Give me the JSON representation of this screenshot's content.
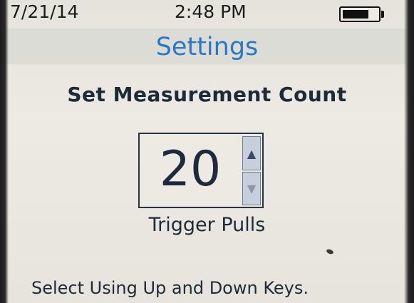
{
  "status_bar": {
    "date": "7/21/14",
    "time": "2:48 PM",
    "battery_level": 0.75
  },
  "header": {
    "title": "Settings"
  },
  "main": {
    "heading": "Set Measurement Count",
    "count_value": "20",
    "up_icon": "triangle-up-icon",
    "down_icon": "triangle-down-icon",
    "unit_label": "Trigger Pulls"
  },
  "footer": {
    "hint": "Select Using Up and Down Keys."
  },
  "colors": {
    "title": "#2a78c4",
    "text": "#1e2a36",
    "background": "#eceae3"
  }
}
